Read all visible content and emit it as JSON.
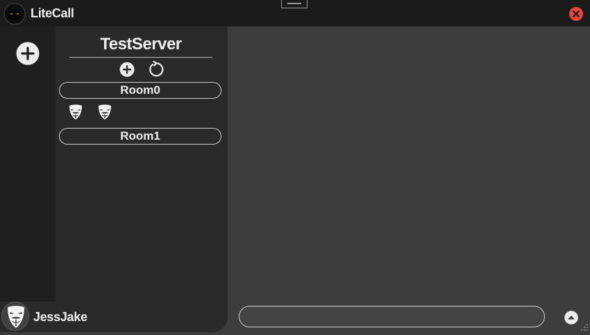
{
  "app": {
    "title": "LiteCall",
    "logo_icon": "cat-logo-icon"
  },
  "titlebar": {
    "close_icon": "close-icon",
    "accent": "#e5473f"
  },
  "server_rail": {
    "add_server_icon": "plus-circle-icon"
  },
  "server": {
    "name": "TestServer",
    "add_room_icon": "plus-circle-icon",
    "refresh_icon": "refresh-icon",
    "rooms": [
      {
        "name": "Room0",
        "members": [
          {
            "avatar_icon": "mask-icon"
          },
          {
            "avatar_icon": "mask-icon"
          }
        ]
      },
      {
        "name": "Room1",
        "members": []
      }
    ]
  },
  "user": {
    "name": "JessJake",
    "avatar_icon": "mask-icon"
  },
  "message": {
    "value": "",
    "placeholder": ""
  },
  "send_icon": "arrow-up-circle-icon"
}
